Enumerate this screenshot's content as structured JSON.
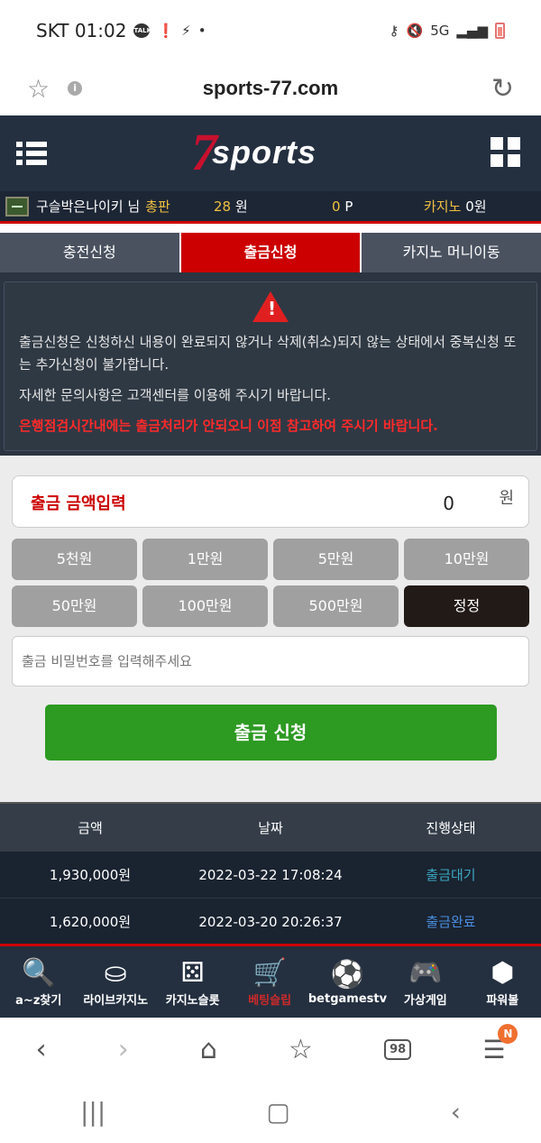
{
  "status": {
    "carrier_time": "SKT 01:02",
    "talk": "TALK",
    "net": "5G"
  },
  "browser": {
    "url": "sports-77.com"
  },
  "site": {
    "logo_mark": "7",
    "logo_text": "sports"
  },
  "user": {
    "name": "구슬박은나이키 님",
    "rank": "총판",
    "money_value": "28",
    "money_unit": "원",
    "points_value": "0",
    "points_unit": "P",
    "casino_label": "카지노",
    "casino_value": "0원"
  },
  "tabs": [
    {
      "label": "충전신청"
    },
    {
      "label": "출금신청"
    },
    {
      "label": "카지노 머니이동"
    }
  ],
  "notice": {
    "line1": "출금신청은 신청하신 내용이 완료되지 않거나 삭제(취소)되지 않는 상태에서 중복신청 또는 추가신청이 불가합니다.",
    "line2": "자세한 문의사항은 고객센터를 이용해 주시기 바랍니다.",
    "line3": "은행점검시간내에는 출금처리가 안되오니 이점 참고하여 주시기 바랍니다."
  },
  "form": {
    "amount_label": "출금 금액입력",
    "amount_value": "0",
    "amount_unit": "원",
    "quick_buttons": [
      "5천원",
      "1만원",
      "5만원",
      "10만원",
      "50만원",
      "100만원",
      "500만원",
      "정정"
    ],
    "password_placeholder": "출금 비밀번호를 입력해주세요",
    "submit_label": "출금 신청"
  },
  "history": {
    "headers": [
      "금액",
      "날짜",
      "진행상태"
    ],
    "rows": [
      {
        "amount": "1,930,000원",
        "date": "2022-03-22 17:08:24",
        "status": "출금대기"
      },
      {
        "amount": "1,620,000원",
        "date": "2022-03-20 20:26:37",
        "status": "출금완료"
      }
    ]
  },
  "bottom_nav": [
    {
      "label": "a~z찾기",
      "icon": "search-icon"
    },
    {
      "label": "라이브카지노",
      "icon": "chip-icon"
    },
    {
      "label": "카지노슬롯",
      "icon": "dice-icon"
    },
    {
      "label": "베팅슬립",
      "icon": "cart-icon"
    },
    {
      "label": "betgamestv",
      "icon": "ball-icon"
    },
    {
      "label": "가상게임",
      "icon": "gamepad-icon"
    },
    {
      "label": "파워볼",
      "icon": "box-icon"
    }
  ],
  "browser_nav": {
    "tab_count": "98",
    "badge": "N"
  }
}
